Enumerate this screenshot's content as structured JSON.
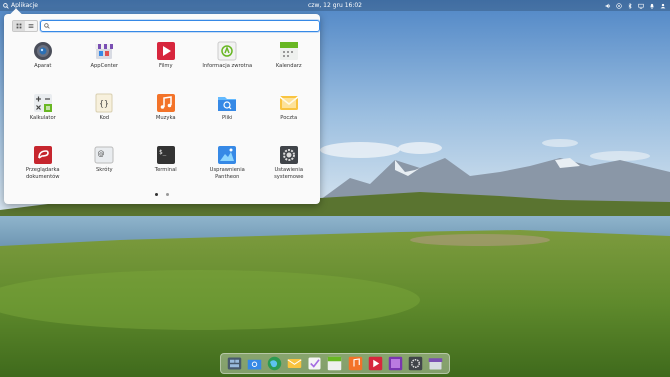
{
  "panel": {
    "menu_label": "Aplikacje",
    "clock": "czw, 12 gru   16:02"
  },
  "launcher": {
    "search": {
      "value": "",
      "placeholder": ""
    },
    "apps": [
      {
        "id": "aparat",
        "label": "Aparat"
      },
      {
        "id": "appcenter",
        "label": "AppCenter"
      },
      {
        "id": "filmy",
        "label": "Filmy"
      },
      {
        "id": "informacja",
        "label": "Informacja zwrotna"
      },
      {
        "id": "kalendarz",
        "label": "Kalendarz"
      },
      {
        "id": "kalkulator",
        "label": "Kalkulator"
      },
      {
        "id": "kod",
        "label": "Kod"
      },
      {
        "id": "muzyka",
        "label": "Muzyka"
      },
      {
        "id": "pliki",
        "label": "Pliki"
      },
      {
        "id": "poczta",
        "label": "Poczta"
      },
      {
        "id": "przegladarka",
        "label": "Przeglądarka dokumentów"
      },
      {
        "id": "skroty",
        "label": "Skróty"
      },
      {
        "id": "terminal",
        "label": "Terminal"
      },
      {
        "id": "usprawnienia",
        "label": "Usprawnienia Pantheon"
      },
      {
        "id": "ustawienia",
        "label": "Ustawienia systemowe"
      }
    ],
    "pages": {
      "count": 2,
      "current": 1
    }
  },
  "dock": {
    "items": [
      "multitasking-icon",
      "files-icon",
      "browser-icon",
      "mail-icon",
      "tasks-icon",
      "calendar-icon",
      "music-icon",
      "videos-icon",
      "photos-icon",
      "settings-icon",
      "appcenter-icon"
    ]
  },
  "colors": {
    "accent": "#3689e6",
    "popover": "#fafafa"
  }
}
